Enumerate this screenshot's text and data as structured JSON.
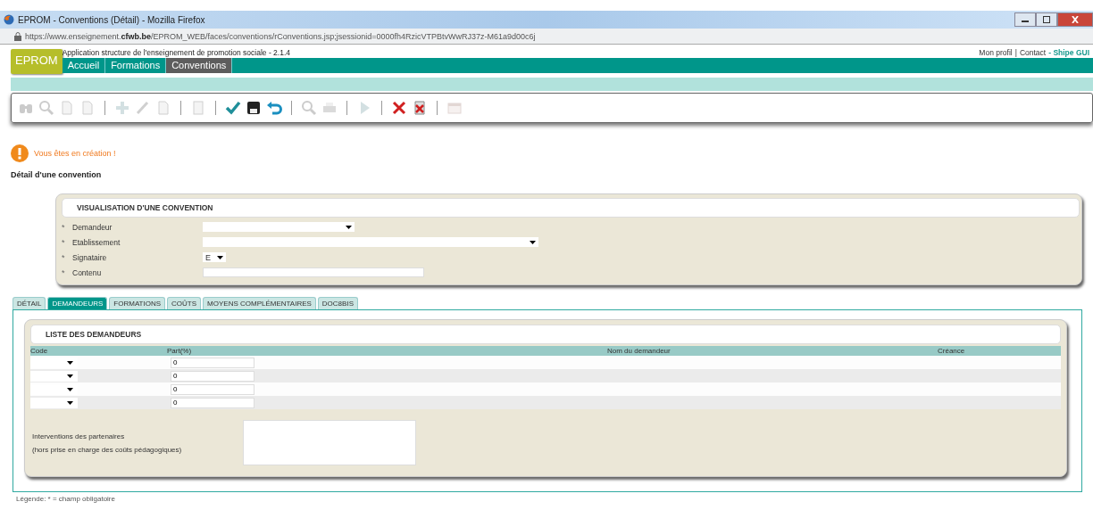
{
  "window": {
    "title": "EPROM - Conventions (Détail) - Mozilla Firefox"
  },
  "address_bar": {
    "prefix": "https://www.enseignement.",
    "domain": "cfwb.be",
    "path": "/EPROM_WEB/faces/conventions/rConventions.jsp;jsessionid=0000fh4RzicVTPBtvWwRJ37z-M61a9d00c6j"
  },
  "app": {
    "logo": "EPROM",
    "subtitle": "Application structure de l'enseignement de promotion sociale - 2.1.4",
    "user_links": [
      "Mon profil",
      "Contact"
    ],
    "link_separator": "|",
    "user_name": "- Shipe GUI"
  },
  "nav": [
    {
      "label": "Accueil",
      "selected": false
    },
    {
      "label": "Formations",
      "selected": false
    },
    {
      "label": "Conventions",
      "selected": true
    }
  ],
  "toolbar": [
    {
      "kind": "binoculars",
      "disabled": true
    },
    {
      "kind": "magnifier",
      "disabled": true
    },
    {
      "kind": "page",
      "disabled": true
    },
    {
      "kind": "page",
      "disabled": true
    },
    {
      "kind": "separator"
    },
    {
      "kind": "plus",
      "disabled": true
    },
    {
      "kind": "pencil",
      "disabled": true
    },
    {
      "kind": "page",
      "disabled": true
    },
    {
      "kind": "separator"
    },
    {
      "kind": "clipboard",
      "disabled": true
    },
    {
      "kind": "separator"
    },
    {
      "kind": "check",
      "disabled": false
    },
    {
      "kind": "floppy",
      "disabled": false
    },
    {
      "kind": "undo",
      "disabled": false
    },
    {
      "kind": "separator"
    },
    {
      "kind": "magnifier",
      "disabled": true
    },
    {
      "kind": "printer",
      "disabled": true
    },
    {
      "kind": "separator"
    },
    {
      "kind": "play",
      "disabled": true
    },
    {
      "kind": "separator"
    },
    {
      "kind": "cross",
      "disabled": false
    },
    {
      "kind": "crossdoc",
      "disabled": false
    },
    {
      "kind": "separator"
    },
    {
      "kind": "calendar",
      "disabled": true
    }
  ],
  "message": "Vous êtes en création !",
  "page_title": "Détail d'une convention",
  "panel": {
    "title": "VISUALISATION D'UNE CONVENTION",
    "fields": [
      {
        "required_mark": "*",
        "label": "Demandeur",
        "kind": "select"
      },
      {
        "required_mark": "*",
        "label": "Etablissement",
        "kind": "wideselect"
      },
      {
        "required_mark": "*",
        "label": "Signataire",
        "kind": "shortselect",
        "value": "E"
      },
      {
        "required_mark": "*",
        "label": "Contenu",
        "kind": "text"
      }
    ]
  },
  "tabs": [
    {
      "label": "DÉTAIL",
      "selected": false
    },
    {
      "label": "DEMANDEURS",
      "selected": true
    },
    {
      "label": "FORMATIONS",
      "selected": false
    },
    {
      "label": "COÛTS",
      "selected": false
    },
    {
      "label": "MOYENS COMPLÉMENTAIRES",
      "selected": false
    },
    {
      "label": "DOC8BIS",
      "selected": false
    }
  ],
  "list": {
    "title": "LISTE DES DEMANDEURS",
    "columns": [
      "Code",
      "Part(%)",
      "Nom du demandeur",
      "Créance"
    ],
    "rows": [
      {
        "part": "0"
      },
      {
        "part": "0"
      },
      {
        "part": "0"
      },
      {
        "part": "0"
      }
    ],
    "interventions_label": [
      "Interventions des partenaires",
      "(hors prise en charge des coûts pédagogiques)"
    ]
  },
  "legend": "Légende:   * = champ obligatoire"
}
